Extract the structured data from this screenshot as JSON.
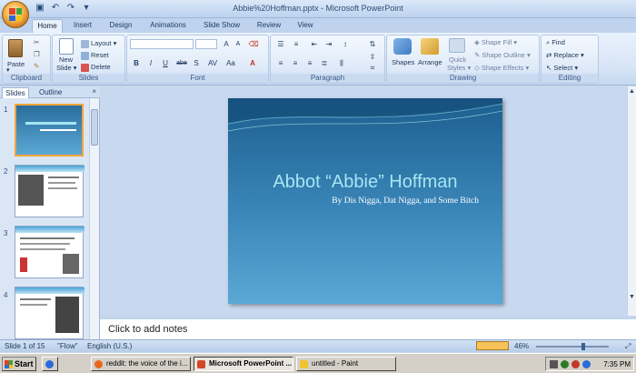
{
  "window": {
    "title": "Abbie%20Hoffman.pptx - Microsoft PowerPoint"
  },
  "tabs": [
    "Home",
    "Insert",
    "Design",
    "Animations",
    "Slide Show",
    "Review",
    "View"
  ],
  "ribbon": {
    "clipboard": {
      "label": "Clipboard",
      "paste": "Paste"
    },
    "slides": {
      "label": "Slides",
      "new_slide_1": "New",
      "new_slide_2": "Slide",
      "layout": "Layout",
      "reset": "Reset",
      "delete": "Delete"
    },
    "font": {
      "label": "Font",
      "bold": "B",
      "italic": "I",
      "underline": "U",
      "strike": "abe",
      "shadow": "S"
    },
    "paragraph": {
      "label": "Paragraph"
    },
    "drawing": {
      "label": "Drawing",
      "shapes": "Shapes",
      "arrange": "Arrange",
      "quick_1": "Quick",
      "quick_2": "Styles",
      "shape_fill": "Shape Fill",
      "shape_outline": "Shape Outline",
      "shape_effects": "Shape Effects"
    },
    "editing": {
      "label": "Editing",
      "find": "Find",
      "replace": "Replace",
      "select": "Select"
    }
  },
  "pane": {
    "tab_slides": "Slides",
    "tab_outline": "Outline",
    "numbers": [
      "1",
      "2",
      "3",
      "4"
    ]
  },
  "slide": {
    "title": "Abbot “Abbie” Hoffman",
    "subtitle": "By Dis Nigga, Dat Nigga, and Some Bitch"
  },
  "notes": {
    "placeholder": "Click to add notes"
  },
  "status": {
    "slide_of": "Slide 1 of 15",
    "theme": "\"Flow\"",
    "language": "English (U.S.)",
    "zoom": "46%"
  },
  "taskbar": {
    "start": "Start",
    "tasks": [
      "reddit: the voice of the i...",
      "Microsoft PowerPoint ...",
      "untitled - Paint"
    ],
    "clock": "7:35 PM"
  }
}
